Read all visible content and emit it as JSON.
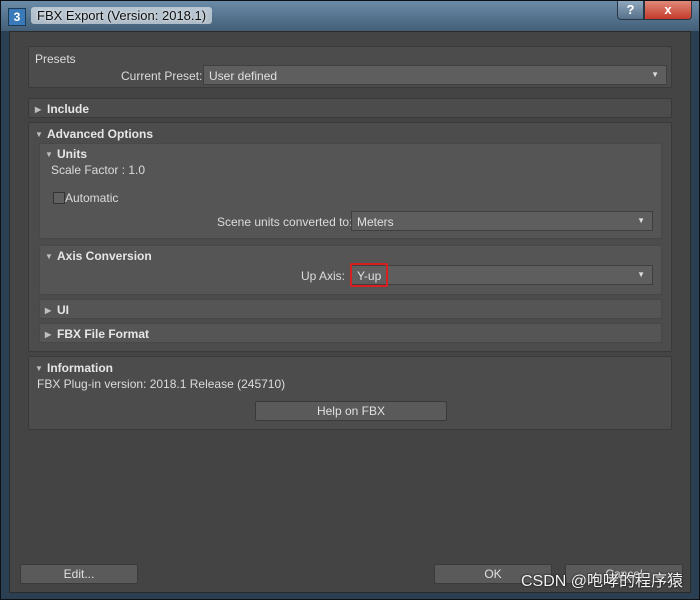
{
  "window": {
    "app_icon_text": "3",
    "title": "FBX Export (Version: 2018.1)",
    "help_button": "?",
    "close_button": "x"
  },
  "presets": {
    "header": "Presets",
    "current_preset_label": "Current Preset:",
    "current_preset_value": "User defined"
  },
  "include": {
    "header": "Include"
  },
  "advanced": {
    "header": "Advanced Options",
    "units": {
      "header": "Units",
      "scale_factor": "Scale Factor : 1.0",
      "automatic_label": "Automatic",
      "scene_units_label": "Scene units converted to:",
      "scene_units_value": "Meters"
    },
    "axis": {
      "header": "Axis Conversion",
      "up_axis_label": "Up Axis:",
      "up_axis_value": "Y-up"
    },
    "ui": {
      "header": "UI"
    },
    "fbx_file_format": {
      "header": "FBX File Format"
    }
  },
  "information": {
    "header": "Information",
    "plugin_version": "FBX Plug-in version: 2018.1 Release (245710)",
    "help_button": "Help on FBX"
  },
  "footer": {
    "edit_button": "Edit...",
    "ok_button": "OK",
    "cancel_button": "Cancel"
  },
  "watermark": "CSDN @咆哮的程序猿",
  "colors": {
    "dialog_bg": "#444444",
    "panel_bg": "#4c4c4c",
    "highlight": "#d82020"
  }
}
